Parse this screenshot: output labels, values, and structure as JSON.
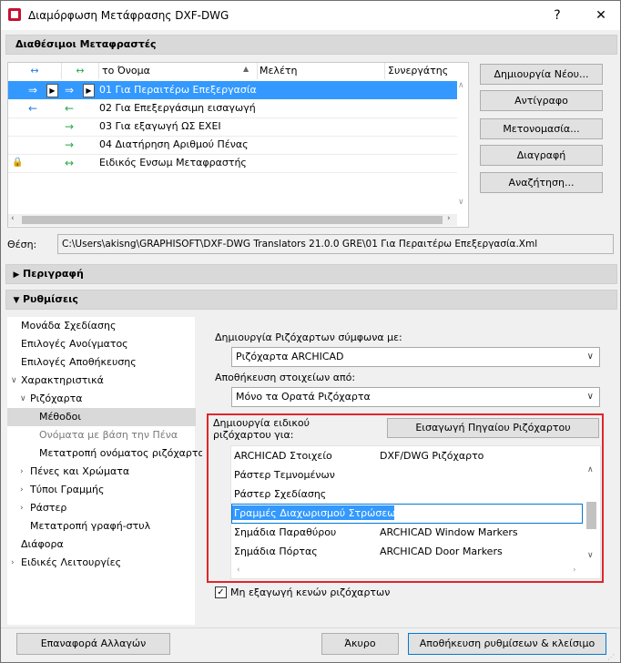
{
  "window": {
    "title": "Διαμόρφωση Μετάφρασης DXF-DWG",
    "help_label": "?",
    "close_label": "✕"
  },
  "translators_section": {
    "title": "Διαθέσιμοι Μεταφραστές"
  },
  "table": {
    "headers": {
      "col1": "↔",
      "col2": "↔",
      "name": "το Όνομα",
      "project": "Μελέτη",
      "teamwork": "Συνεργάτης"
    },
    "rows": [
      {
        "a1": "⇒",
        "a2": "⇒",
        "name": "01 Για Περαιτέρω Επεξεργασία",
        "selected": true
      },
      {
        "a1": "←",
        "a2": "←",
        "name": "02 Για Επεξεργάσιμη εισαγωγή",
        "selected": false
      },
      {
        "a1": "",
        "a2": "→",
        "name": "03 Για εξαγωγή ΩΣ ΕΧΕΙ",
        "selected": false
      },
      {
        "a1": "",
        "a2": "→",
        "name": "04 Διατήρηση Αριθμού Πένας",
        "selected": false
      },
      {
        "a1": "🔒",
        "a2": "↔",
        "name": "Ειδικός Ενσωμ Μεταφραστής",
        "selected": false
      }
    ]
  },
  "side_buttons": {
    "new": "Δημιουργία Νέου...",
    "copy": "Αντίγραφο",
    "rename": "Μετονομασία...",
    "delete": "Διαγραφή",
    "search": "Αναζήτηση..."
  },
  "location": {
    "label": "Θέση:",
    "path": "C:\\Users\\akisng\\GRAPHISOFT\\DXF-DWG Translators 21.0.0 GRE\\01 Για Περαιτέρω Επεξεργασία.Xml"
  },
  "description_section": {
    "title": "Περιγραφή"
  },
  "settings_section": {
    "title": "Ρυθμίσεις"
  },
  "tree": [
    {
      "label": "Μονάδα Σχεδίασης",
      "exp": ""
    },
    {
      "label": "Επιλογές Ανοίγματος",
      "exp": ""
    },
    {
      "label": "Επιλογές Αποθήκευσης",
      "exp": ""
    },
    {
      "label": "Χαρακτηριστικά",
      "exp": "∨"
    },
    {
      "label": "Ριζόχαρτα",
      "exp": "∨"
    },
    {
      "label": "Μέθοδοι",
      "exp": ""
    },
    {
      "label": "Ονόματα με βάση την Πένα",
      "exp": ""
    },
    {
      "label": "Μετατροπή ονόματος ριζόχαρτο",
      "exp": ""
    },
    {
      "label": "Πένες και Χρώματα",
      "exp": "›"
    },
    {
      "label": "Τύποι Γραμμής",
      "exp": "›"
    },
    {
      "label": "Ράστερ",
      "exp": "›"
    },
    {
      "label": "Μετατροπή γραφή-στυλ",
      "exp": ""
    },
    {
      "label": "Διάφορα",
      "exp": ""
    },
    {
      "label": "Ειδικές Λειτουργίες",
      "exp": "›"
    }
  ],
  "methods": {
    "create_label": "Δημιουργία Ριζόχαρτων σύμφωνα με:",
    "create_value": "Ριζόχαρτα ARCHICAD",
    "save_label": "Αποθήκευση στοιχείων από:",
    "save_value": "Μόνο τα Ορατά Ριζόχαρτα",
    "special_label_1": "Δημιουργία ειδικού",
    "special_label_2": "ριζόχαρτου για:",
    "import_button": "Εισαγωγή Πηγαίου Ριζόχαρτου",
    "mapping": [
      {
        "element": "ARCHICAD Στοιχείο",
        "layer": "DXF/DWG Ριζόχαρτο"
      },
      {
        "element": "Ράστερ Τεμνομένων",
        "layer": ""
      },
      {
        "element": "Ράστερ Σχεδίασης",
        "layer": ""
      },
      {
        "element": "Γραμμές Διαχωρισμού Στρώσεων",
        "layer": ""
      },
      {
        "element": "Σημάδια Παραθύρου",
        "layer": "ARCHICAD Window Markers"
      },
      {
        "element": "Σημάδια Πόρτας",
        "layer": "ARCHICAD Door Markers"
      }
    ],
    "checkbox_label": "Μη εξαγωγή κενών ριζόχαρτων"
  },
  "footer": {
    "reset": "Επαναφορά Αλλαγών",
    "cancel": "Άκυρο",
    "save_close": "Αποθήκευση ρυθμίσεων & κλείσιμο"
  },
  "colors": {
    "accent": "#3399ff",
    "highlight_border": "#e0262b"
  }
}
